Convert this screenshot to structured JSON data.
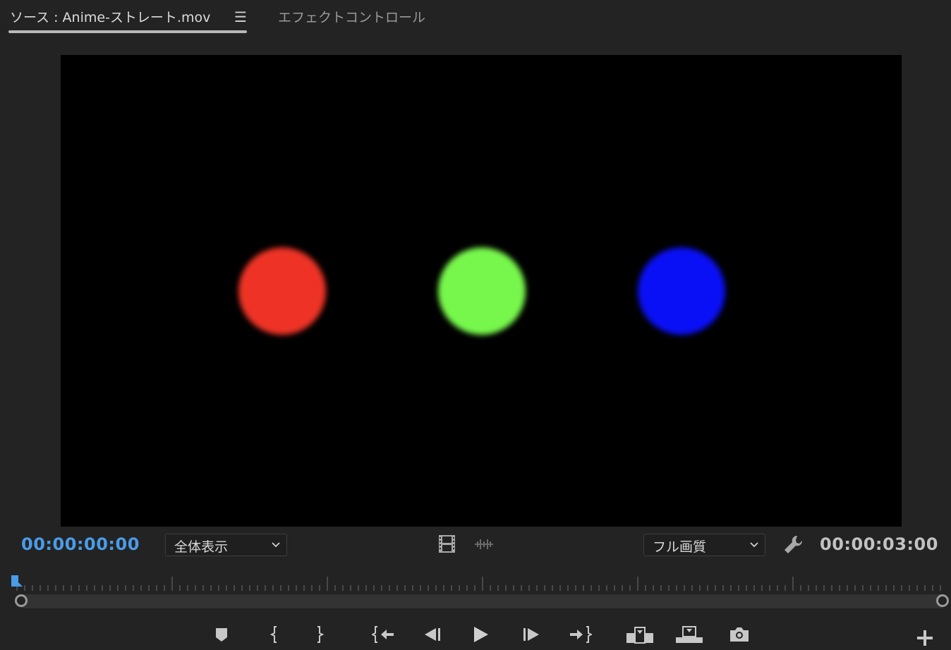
{
  "tabs": {
    "active": "ソース : Anime-ストレート.mov",
    "menu_icon": "hamburger-menu-icon",
    "inactive": "エフェクトコントロール"
  },
  "viewer": {
    "dots": [
      {
        "color": "#ee3326"
      },
      {
        "color": "#77f74c"
      },
      {
        "color": "#0a10f5"
      }
    ]
  },
  "status": {
    "current_time": "00:00:00:00",
    "zoom": "全体表示",
    "quality": "フル画質",
    "duration": "00:00:03:00",
    "icons": [
      "film-strip-icon",
      "audio-waveform-icon",
      "wrench-icon"
    ]
  },
  "controls": {
    "buttons": [
      "add-marker",
      "mark-in",
      "mark-out",
      "go-to-in",
      "step-back",
      "play",
      "step-forward",
      "go-to-out",
      "insert",
      "overwrite",
      "export-frame",
      "button-editor"
    ]
  },
  "colors": {
    "accent": "#4a9ce8",
    "background": "#232323",
    "viewer": "#000000"
  }
}
